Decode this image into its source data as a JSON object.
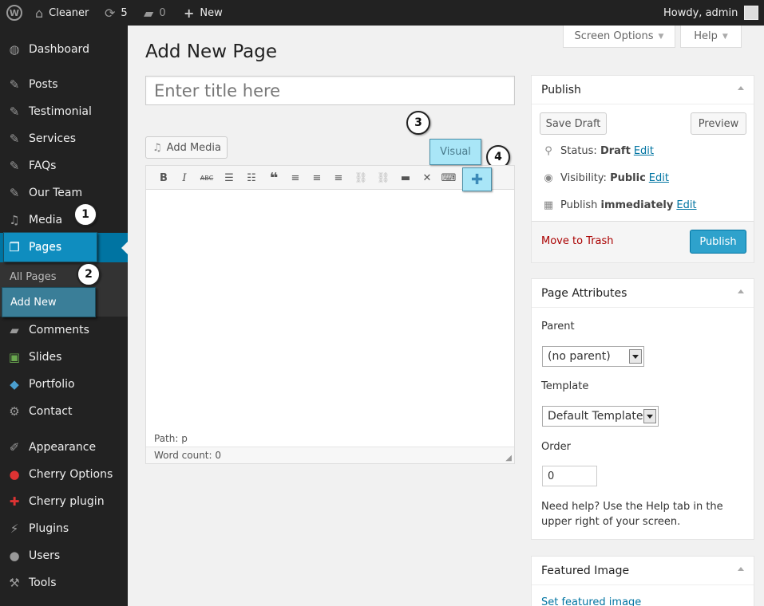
{
  "adminbar": {
    "site_name": "Cleaner",
    "updates_count": "5",
    "comments_count": "0",
    "new_label": "New",
    "howdy": "Howdy, admin"
  },
  "menu": {
    "items": [
      {
        "label": "Dashboard",
        "icon": "dashboard-icon"
      },
      {
        "label": "Posts",
        "icon": "pin-icon"
      },
      {
        "label": "Testimonial",
        "icon": "pin-icon"
      },
      {
        "label": "Services",
        "icon": "pin-icon"
      },
      {
        "label": "FAQs",
        "icon": "pin-icon"
      },
      {
        "label": "Our Team",
        "icon": "pin-icon"
      },
      {
        "label": "Media",
        "icon": "media-icon"
      },
      {
        "label": "Pages",
        "icon": "pages-icon"
      },
      {
        "label": "Comments",
        "icon": "comment-icon"
      },
      {
        "label": "Slides",
        "icon": "slides-icon"
      },
      {
        "label": "Portfolio",
        "icon": "portfolio-icon"
      },
      {
        "label": "Contact",
        "icon": "gear-icon"
      },
      {
        "label": "Appearance",
        "icon": "brush-icon"
      },
      {
        "label": "Cherry Options",
        "icon": "cherry-icon"
      },
      {
        "label": "Cherry plugin",
        "icon": "plugin-icon"
      },
      {
        "label": "Plugins",
        "icon": "plug-icon"
      },
      {
        "label": "Users",
        "icon": "user-icon"
      },
      {
        "label": "Tools",
        "icon": "wrench-icon"
      }
    ],
    "submenu": {
      "all_pages": "All Pages",
      "add_new": "Add New"
    }
  },
  "callouts": [
    "1",
    "2",
    "3",
    "4"
  ],
  "header": {
    "screen_options": "Screen Options",
    "help": "Help",
    "title": "Add New Page"
  },
  "editor": {
    "title_placeholder": "Enter title here",
    "add_media": "Add Media",
    "visual_tab": "Visual",
    "path": "Path: p",
    "word_count": "Word count: 0"
  },
  "publish": {
    "title": "Publish",
    "save_draft": "Save Draft",
    "preview": "Preview",
    "status_label": "Status:",
    "status_value": "Draft",
    "visibility_label": "Visibility:",
    "visibility_value": "Public",
    "publish_label": "Publish",
    "publish_value": "immediately",
    "edit": "Edit",
    "move_to_trash": "Move to Trash",
    "publish_button": "Publish"
  },
  "page_attributes": {
    "title": "Page Attributes",
    "parent_label": "Parent",
    "parent_value": "(no parent)",
    "template_label": "Template",
    "template_value": "Default Template",
    "order_label": "Order",
    "order_value": "0",
    "help_text": "Need help? Use the Help tab in the upper right of your screen."
  },
  "featured_image": {
    "title": "Featured Image",
    "link": "Set featured image"
  },
  "colors": {
    "accent": "#0074a2",
    "publish_button": "#2ea2cc",
    "highlight": "#a9e6f7",
    "trash": "#aa0000"
  }
}
